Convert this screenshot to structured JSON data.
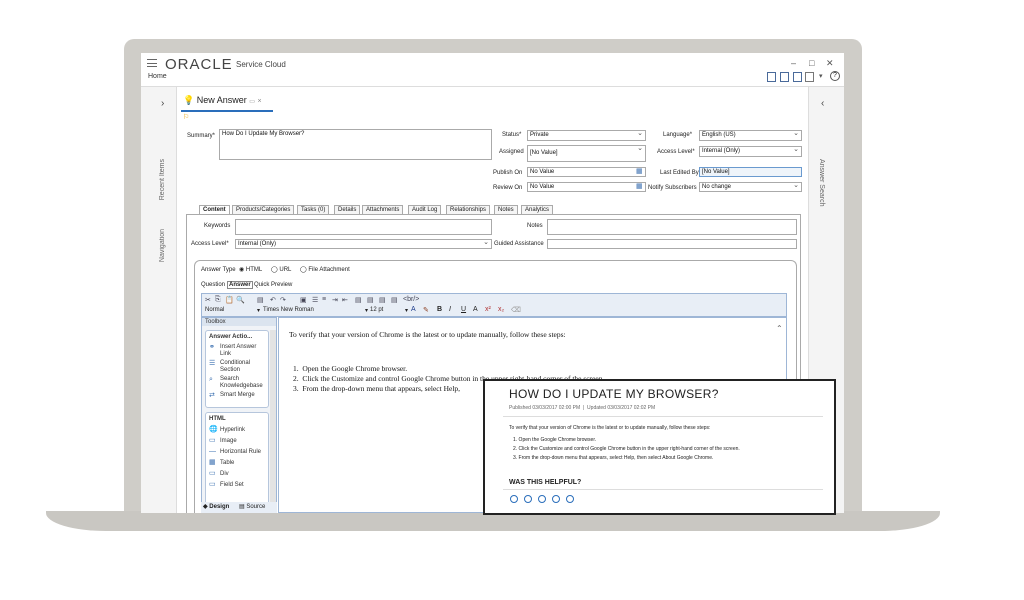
{
  "app": {
    "logo": "ORACLE",
    "product": "Service Cloud",
    "home": "Home",
    "win_min": "–",
    "win_max": "□",
    "win_close": "✕",
    "help": "?"
  },
  "sidebar": {
    "left": [
      "Recent Items",
      "Navigation"
    ],
    "right": [
      "Answer Search"
    ],
    "left_chevron": "›",
    "right_chevron": "‹"
  },
  "doc_tab": {
    "label": "New Answer",
    "close": "×"
  },
  "fields": {
    "summary_label": "Summary*",
    "summary_value": "How Do I Update My Browser?",
    "status_label": "Status*",
    "status_value": "Private",
    "assigned_label": "Assigned",
    "assigned_value": "[No Value]",
    "publish_label": "Publish On",
    "publish_value": "No Value",
    "review_label": "Review On",
    "review_value": "No Value",
    "language_label": "Language*",
    "language_value": "English (US)",
    "access_label": "Access Level*",
    "access_value": "Internal (Only)",
    "edited_label": "Last Edited By",
    "edited_value": "[No Value]",
    "notify_label": "Notify Subscribers",
    "notify_value": "No change"
  },
  "section_tabs": [
    "Content",
    "Products/Categories",
    "Tasks (0)",
    "Details",
    "Attachments",
    "Audit Log",
    "Relationships",
    "Notes",
    "Analytics"
  ],
  "content": {
    "keywords_label": "Keywords",
    "notes_label": "Notes",
    "access_label": "Access Level*",
    "access_value": "Internal (Only)",
    "guided_label": "Guided Assistance",
    "answer_type_label": "Answer Type",
    "answer_types": [
      "HTML",
      "URL",
      "File Attachment"
    ],
    "subtabs": [
      "Question",
      "Answer",
      "Quick Preview"
    ]
  },
  "editor": {
    "style": "Normal",
    "font": "Times New Roman",
    "size": "12 pt",
    "br_tag": "<br/>",
    "bold": "B",
    "italic": "I",
    "underline": "U",
    "intro": "To verify that your version of Chrome is the latest or to update manually, follow these steps:",
    "steps": [
      "Open the Google Chrome browser.",
      "Click the Customize and control Google Chrome button in the upper right-hand corner of the screen.",
      "From the drop-down menu that appears, select Help,"
    ],
    "mode_tabs": [
      "Design",
      "Source"
    ]
  },
  "toolbox": {
    "title": "Toolbox",
    "groups": [
      {
        "title": "Answer Actio...",
        "items": [
          "Insert Answer Link",
          "Conditional Section",
          "Search Knowledgebase",
          "Smart Merge"
        ]
      },
      {
        "title": "HTML",
        "items": [
          "Hyperlink",
          "Image",
          "Horizontal Rule",
          "Table",
          "Div",
          "Field Set"
        ]
      }
    ]
  },
  "preview": {
    "title": "HOW DO I UPDATE MY BROWSER?",
    "published": "Published 03/03/2017 02:00 PM",
    "divider": "|",
    "updated": "Updated 03/03/2017 02:02 PM",
    "intro": "To verify that your version of Chrome is the latest or to update manually, follow these steps:",
    "steps": [
      "1.  Open the Google Chrome browser.",
      "2.  Click the Customize and control Google Chrome button in the upper right-hand corner of the screen.",
      "3.  From the drop-down menu that appears, select Help, then select About Google Chrome."
    ],
    "helpful": "WAS THIS HELPFUL?"
  }
}
